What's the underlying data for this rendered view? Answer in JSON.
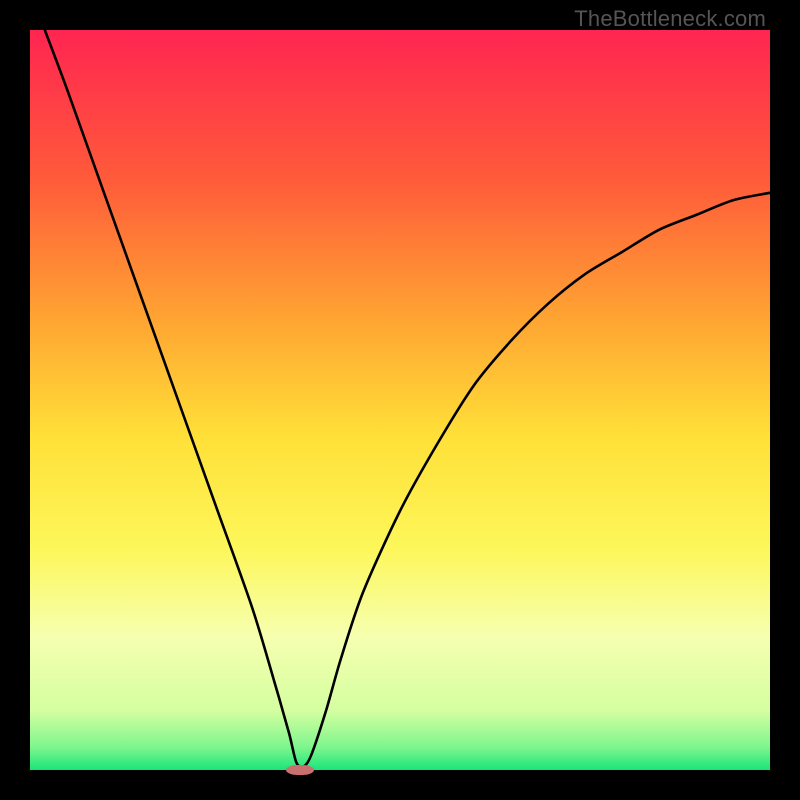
{
  "watermark": "TheBottleneck.com",
  "chart_data": {
    "type": "line",
    "title": "",
    "xlabel": "",
    "ylabel": "",
    "xlim": [
      0,
      100
    ],
    "ylim": [
      0,
      100
    ],
    "grid": false,
    "legend": false,
    "series": [
      {
        "name": "curve",
        "x": [
          2,
          5,
          10,
          15,
          20,
          25,
          30,
          33,
          35,
          36,
          37,
          38,
          40,
          42,
          45,
          50,
          55,
          60,
          65,
          70,
          75,
          80,
          85,
          90,
          95,
          100
        ],
        "y": [
          100,
          92,
          78,
          64,
          50,
          36,
          22,
          12,
          5,
          1,
          0.5,
          2,
          8,
          15,
          24,
          35,
          44,
          52,
          58,
          63,
          67,
          70,
          73,
          75,
          77,
          78
        ]
      }
    ],
    "gradient_stops": [
      {
        "pct": 0,
        "color": "#ff2551"
      },
      {
        "pct": 20,
        "color": "#ff5a3a"
      },
      {
        "pct": 40,
        "color": "#ffa832"
      },
      {
        "pct": 55,
        "color": "#ffe038"
      },
      {
        "pct": 70,
        "color": "#fdf75a"
      },
      {
        "pct": 82,
        "color": "#f6ffb0"
      },
      {
        "pct": 92,
        "color": "#d4ffa0"
      },
      {
        "pct": 97,
        "color": "#7cf58e"
      },
      {
        "pct": 100,
        "color": "#19e57a"
      }
    ],
    "marker": {
      "x": 36.5,
      "y": 0,
      "width_pct": 3.8,
      "height_pct": 1.4,
      "color": "#c86f6f"
    }
  }
}
